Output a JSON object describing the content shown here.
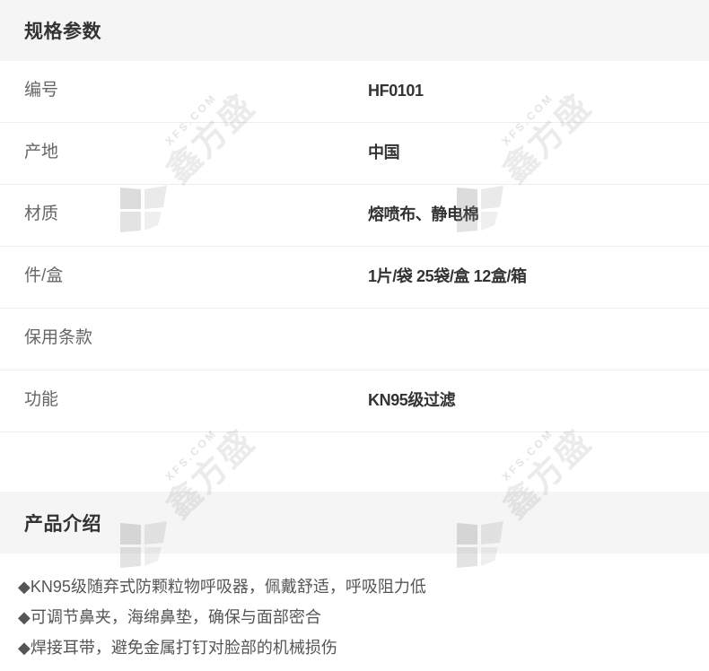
{
  "spec_section": {
    "title": "规格参数",
    "rows": [
      {
        "label": "编号",
        "value": "HF0101"
      },
      {
        "label": "产地",
        "value": "中国"
      },
      {
        "label": "材质",
        "value": "熔喷布、静电棉"
      },
      {
        "label": "件/盒",
        "value": "1片/袋 25袋/盒 12盒/箱"
      },
      {
        "label": "保用条款",
        "value": ""
      },
      {
        "label": "功能",
        "value": "KN95级过滤"
      }
    ]
  },
  "intro_section": {
    "title": "产品介绍",
    "items": [
      "◆KN95级随弃式防颗粒物呼吸器，佩戴舒适，呼吸阻力低",
      "◆可调节鼻夹，海绵鼻垫，确保与面部密合",
      "◆焊接耳带，避免金属打钉对脸部的机械损伤"
    ]
  },
  "watermark": {
    "brand": "鑫方盛",
    "domain": "XFS.COM",
    "icon": "brand-logo-icon"
  },
  "colors": {
    "header_bg": "#f5f5f5",
    "row_border": "#ededed",
    "label": "#666666",
    "value": "#333333",
    "text": "#555555"
  }
}
